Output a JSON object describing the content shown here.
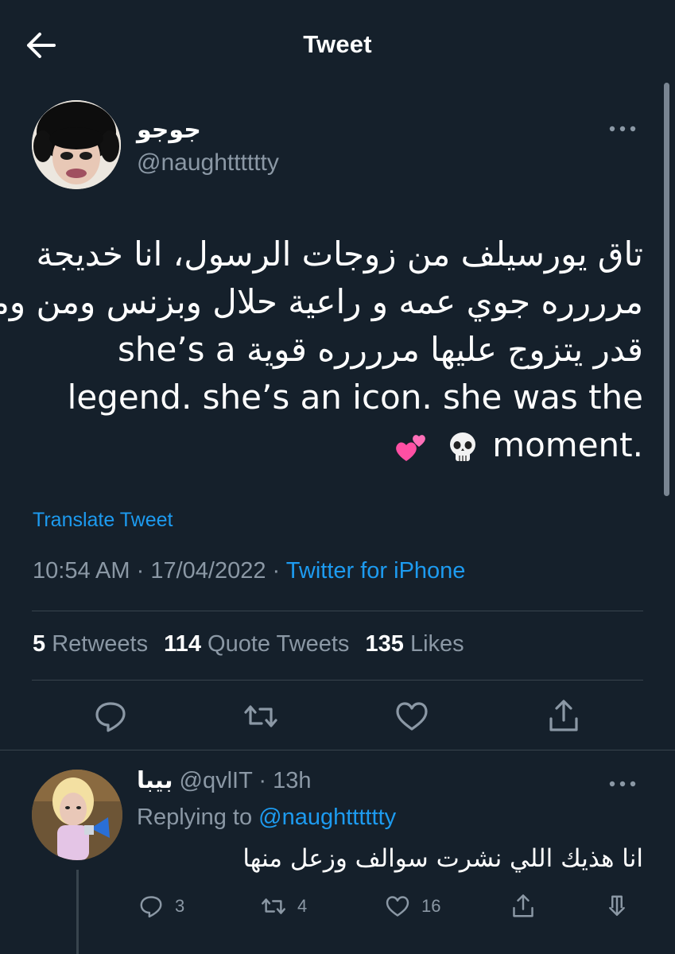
{
  "header": {
    "title": "Tweet",
    "back_icon": "arrow-left-icon"
  },
  "tweet": {
    "author_name": "جوجو",
    "author_handle": "@naughtttttty",
    "text_lines": [
      "تاق يورسيلف من زوجات الرسول، انا خديجة",
      "مرررره جوي عمه و راعية حلال وبزنس ومن وما",
      "قدر يتزوج عليها مرررره قوية she’s a",
      "legend. she’s an icon. she was the",
      ".moment"
    ],
    "emojis": [
      "skull-emoji",
      "two-hearts-emoji"
    ],
    "translate_label": "Translate Tweet",
    "time": "10:54 AM",
    "date": "17/04/2022",
    "source": "Twitter for iPhone",
    "separator": "·",
    "stats": {
      "retweets_count": "5",
      "retweets_label": "Retweets",
      "quotes_count": "114",
      "quotes_label": "Quote Tweets",
      "likes_count": "135",
      "likes_label": "Likes"
    },
    "actions": [
      "reply-icon",
      "retweet-icon",
      "like-icon",
      "share-icon"
    ]
  },
  "reply": {
    "author_name": "بيبا",
    "author_handle": "@qvlIT",
    "time_ago": "13h",
    "replying_to_label": "Replying to",
    "replying_to_handle": "@naughtttttty",
    "text": "انا هذيك اللي نشرت سوالف وزعل منها",
    "counts": {
      "replies": "3",
      "retweets": "4",
      "likes": "16"
    }
  },
  "colors": {
    "background": "#15202b",
    "text": "#ffffff",
    "muted": "#8b98a5",
    "accent": "#1d9bf0",
    "divider": "#38444d"
  }
}
